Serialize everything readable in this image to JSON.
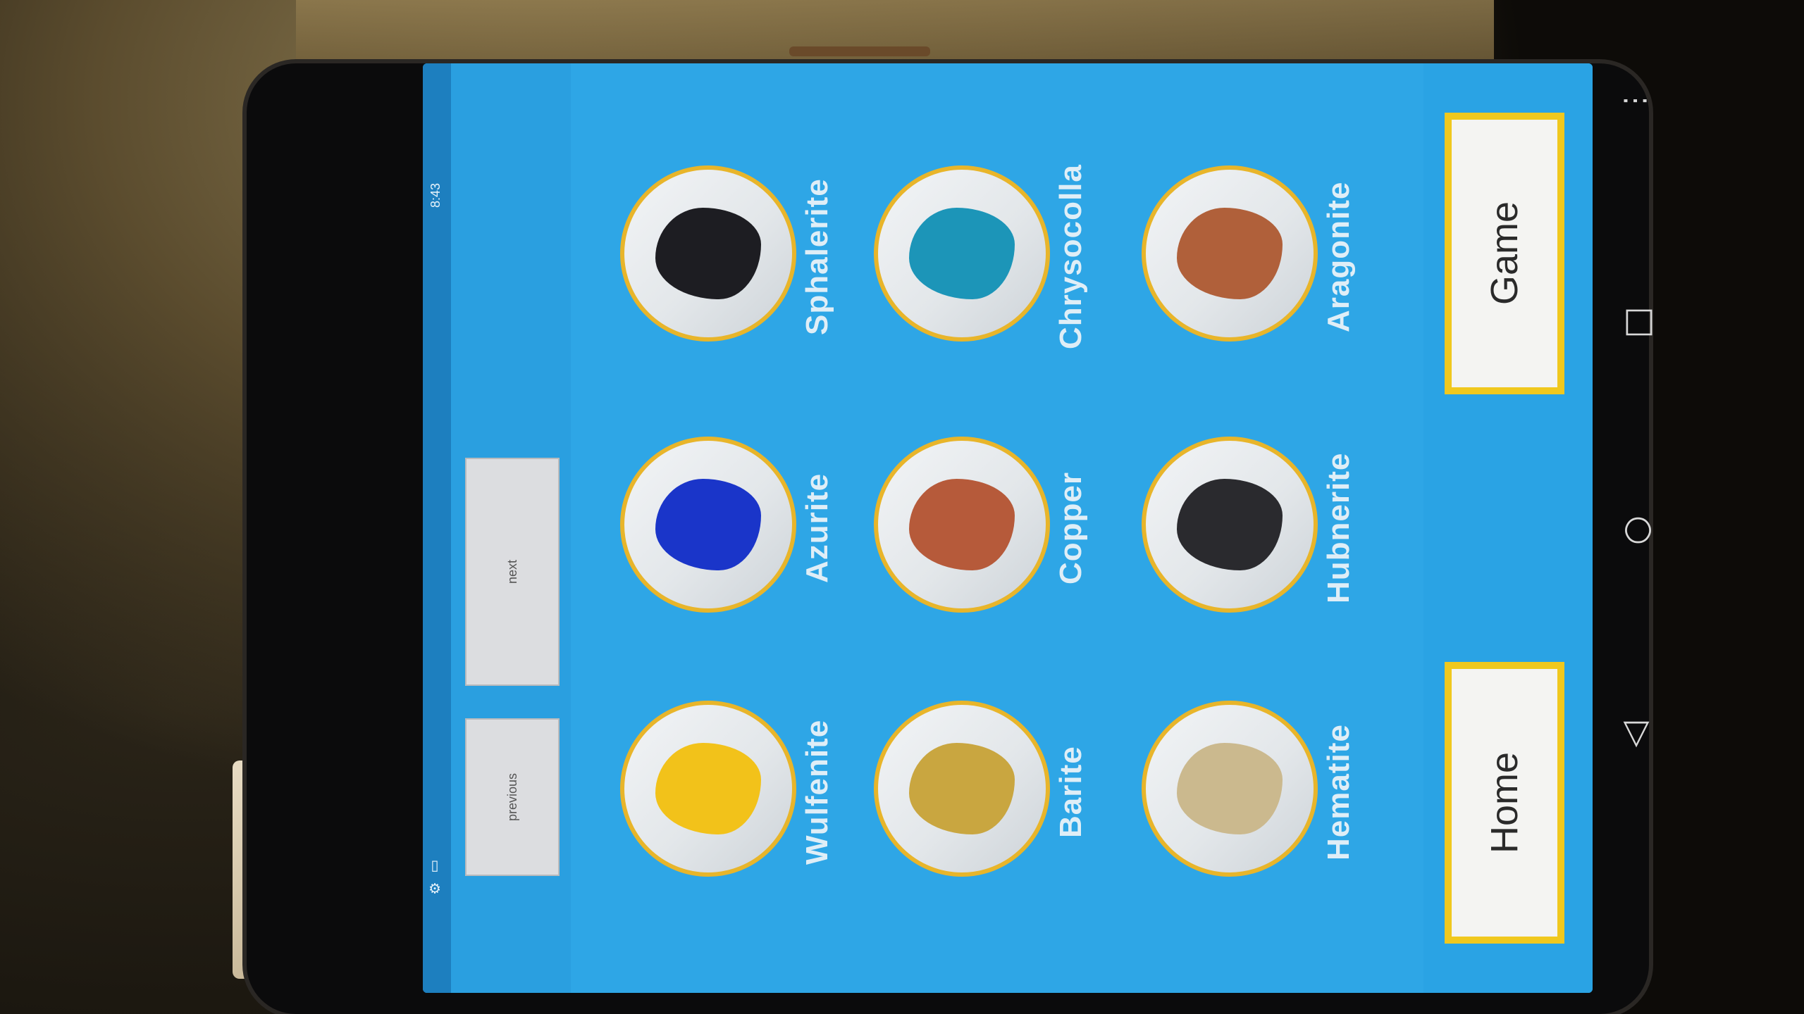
{
  "status": {
    "time": "8:43",
    "icons": "⚙ ▯"
  },
  "toolbar": {
    "previous_label": "previous",
    "next_label": "next"
  },
  "minerals": [
    {
      "name": "Wulfenite",
      "color": "#f2c21a"
    },
    {
      "name": "Azurite",
      "color": "#1a35c9"
    },
    {
      "name": "Sphalerite",
      "color": "#1d1d22"
    },
    {
      "name": "Barite",
      "color": "#c9a640"
    },
    {
      "name": "Copper",
      "color": "#b65a3a"
    },
    {
      "name": "Chrysocolla",
      "color": "#1c95b8"
    },
    {
      "name": "Hematite",
      "color": "#cbb98e"
    },
    {
      "name": "Hubnerite",
      "color": "#2a2a2e"
    },
    {
      "name": "Aragonite",
      "color": "#b0603a"
    }
  ],
  "actions": {
    "home_label": "Home",
    "game_label": "Game"
  },
  "system_nav": {
    "back_icon": "◁",
    "home_icon": "○",
    "recent_icon": "□",
    "menu_icon": "⋮"
  },
  "colors": {
    "screen_bg": "#2ea6e6",
    "ring": "#e8b52a",
    "button_border": "#f0c81e"
  }
}
